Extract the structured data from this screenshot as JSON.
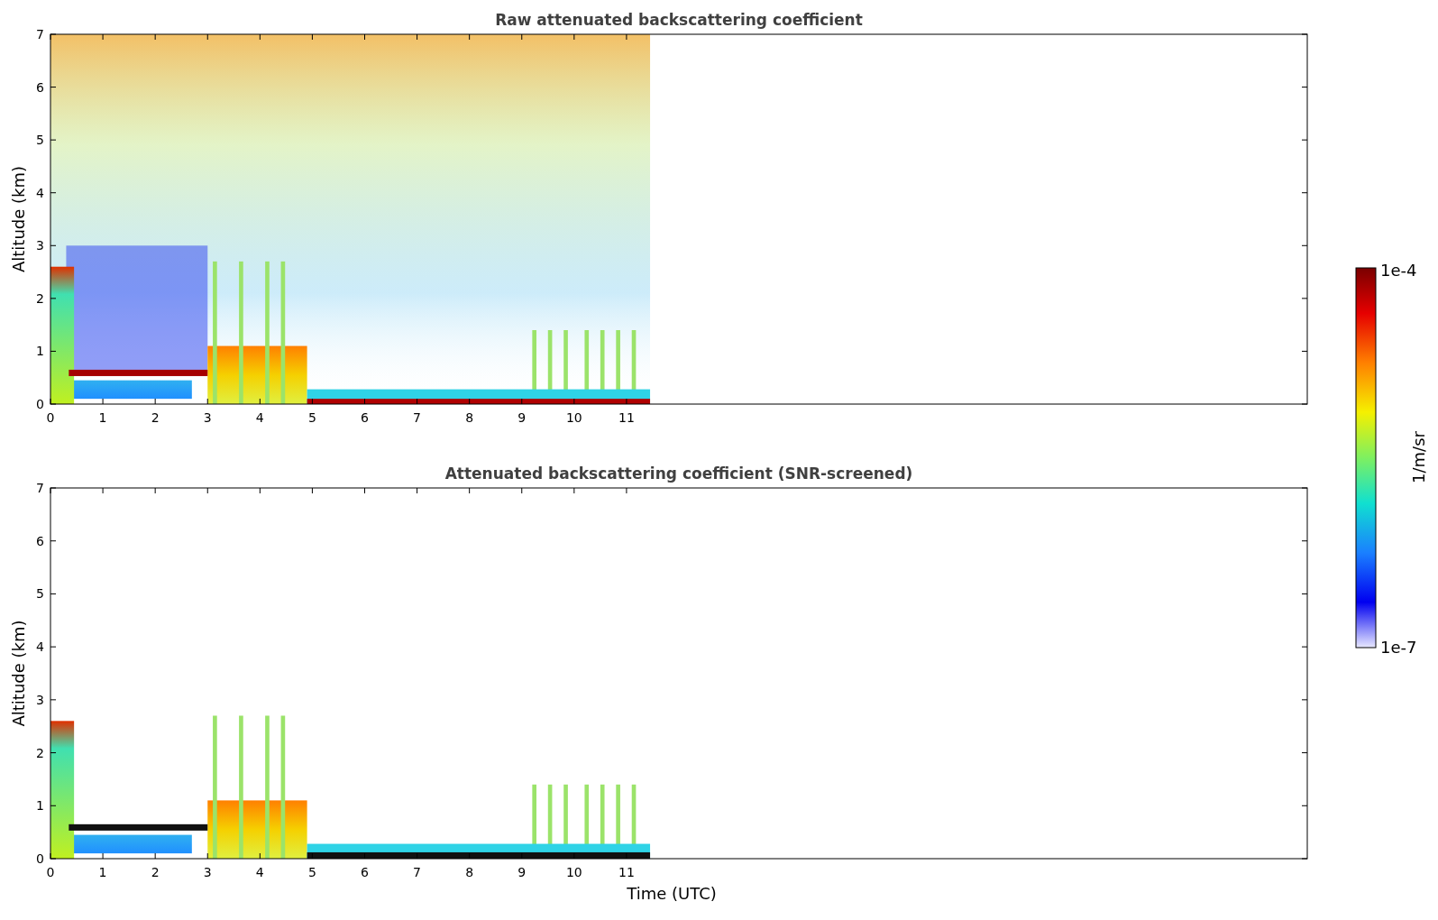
{
  "plots": [
    {
      "title": "Raw attenuated backscattering coefficient",
      "ylabel": "Altitude (km)",
      "yticks": [
        "7",
        "6",
        "5",
        "4",
        "3",
        "2",
        "1",
        "0"
      ],
      "xticks": [
        "0",
        "1",
        "2",
        "3",
        "4",
        "5",
        "6",
        "7",
        "8",
        "9",
        "10",
        "11"
      ],
      "kind": "raw"
    },
    {
      "title": "Attenuated backscattering coefficient (SNR-screened)",
      "ylabel": "Altitude (km)",
      "yticks": [
        "7",
        "6",
        "5",
        "4",
        "3",
        "2",
        "1",
        "0"
      ],
      "xticks": [
        "0",
        "1",
        "2",
        "3",
        "4",
        "5",
        "6",
        "7",
        "8",
        "9",
        "10",
        "11"
      ],
      "xlabel": "Time (UTC)",
      "kind": "screened"
    }
  ],
  "colorbar": {
    "max": "1e-4",
    "min": "1e-7",
    "label": "1/m/sr"
  }
}
